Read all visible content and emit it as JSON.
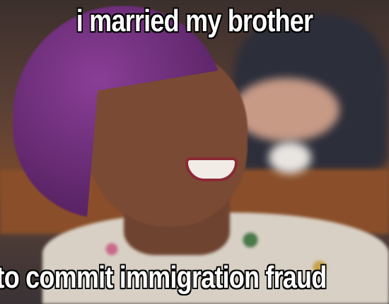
{
  "meme": {
    "top_text": "i married my brother",
    "bottom_text": "to commit immigration fraud"
  },
  "colors": {
    "headwrap": "#6a2c78",
    "caption_fill": "#ffffff",
    "caption_stroke": "#000000"
  }
}
